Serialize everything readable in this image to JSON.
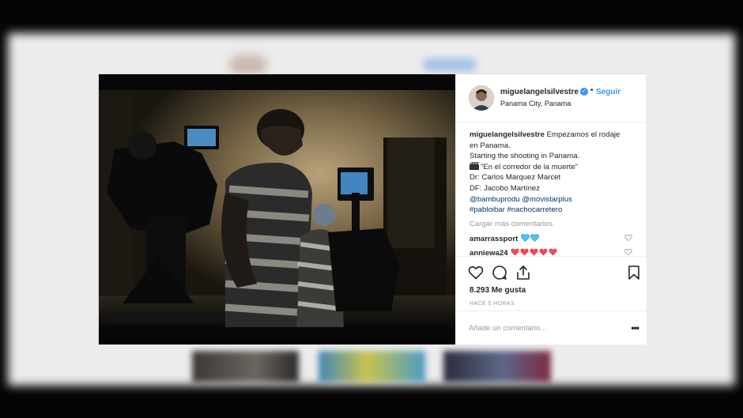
{
  "post": {
    "username": "miguelangelsilvestre",
    "follow_label": "Seguir",
    "location": "Panama City, Panama",
    "caption": {
      "user": "miguelangelsilvestre",
      "line1": "Empezamos el rodaje",
      "line2": "en Panama.",
      "line3": "Starting the shooting in Panama.",
      "line4": "\"En el corredor de la muerte\"",
      "line5": "Dr: Carlos Marquez Marcet",
      "line6": "DF: Jacobo Martínez",
      "line7": "@bambuprodu @movistarplus",
      "line8": "#pabloibar #nachocarretero"
    },
    "load_more": "Cargar más comentarios",
    "comments": [
      {
        "user": "amarrassport",
        "emoji": "blue-hearts"
      },
      {
        "user": "anniewa24",
        "emoji": "red-hearts"
      }
    ],
    "likes": "8.293 Me gusta",
    "time_ago": "HACE 5 HORAS",
    "add_comment_placeholder": "Añade un comentario...",
    "more_options": "•••"
  },
  "colors": {
    "link_blue": "#3897f0",
    "hashtag_blue": "#003569",
    "muted_gray": "#999999",
    "heart_red": "#ed4956",
    "heart_cyan": "#4fc3f7"
  }
}
